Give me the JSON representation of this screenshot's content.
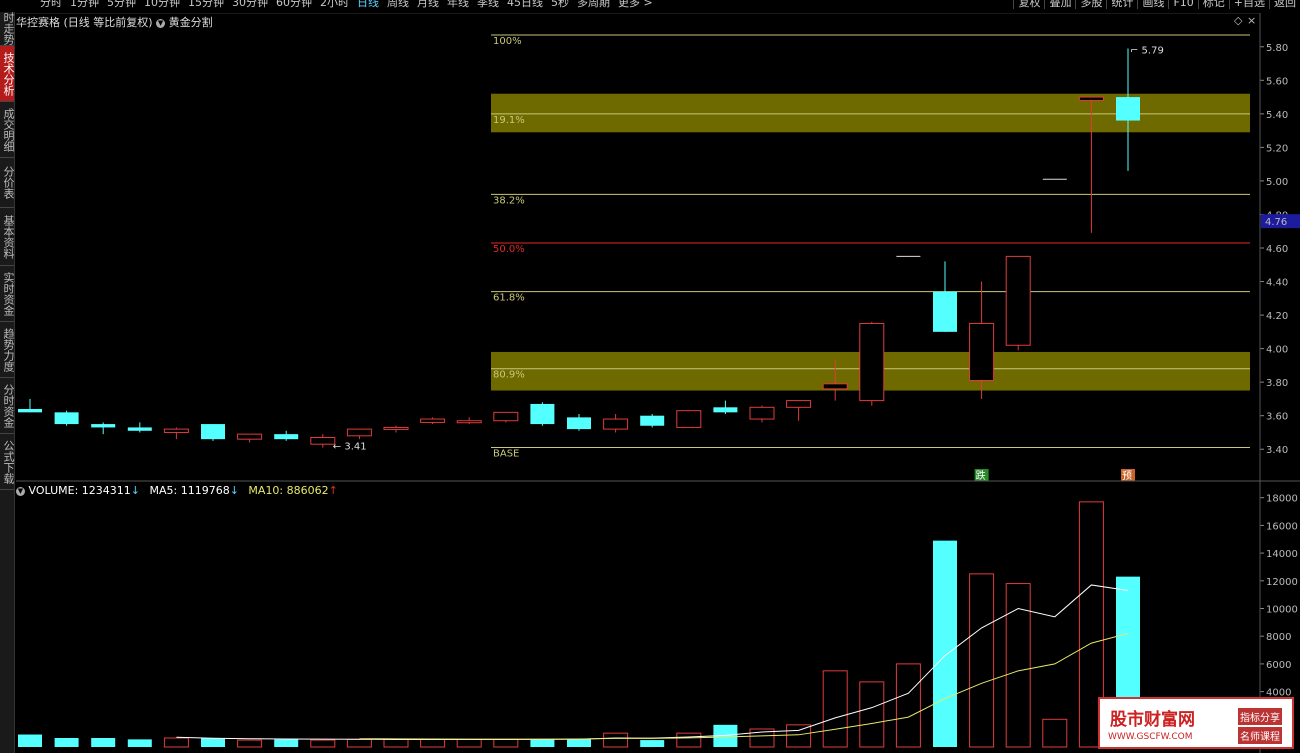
{
  "topbar": {
    "periods": [
      "分时",
      "1分钟",
      "5分钟",
      "10分钟",
      "15分钟",
      "30分钟",
      "60分钟",
      "2小时",
      "日线",
      "周线",
      "月线",
      "年线",
      "季线",
      "45日线",
      "5秒",
      "多周期",
      "更多"
    ],
    "active_period": "日线",
    "right_buttons": [
      "复权",
      "叠加",
      "多股",
      "统计",
      "画线",
      "F10",
      "标记",
      "+自选",
      "返回"
    ]
  },
  "sidetabs": [
    "分时走势",
    "技术分析",
    "成交明细",
    "分价表",
    "基本资料",
    "实时资金",
    "趋势力度",
    "分时资金",
    "公式下载"
  ],
  "active_sidetab": "技术分析",
  "info": {
    "stock_name": "华控赛格",
    "mode": "(日线 等比前复权)",
    "indicator": "黄金分割"
  },
  "price_axis": [
    "5.80",
    "5.60",
    "5.40",
    "5.20",
    "5.00",
    "4.80",
    "4.60",
    "4.40",
    "4.20",
    "4.00",
    "3.80",
    "3.60",
    "3.40"
  ],
  "current_price_tag": "4.76",
  "fib_levels": [
    {
      "label": "100%",
      "price": 5.87,
      "color": "#c8c878"
    },
    {
      "label": "19.1%",
      "price": 5.4,
      "color": "#c8c878"
    },
    {
      "label": "38.2%",
      "price": 4.92,
      "color": "#c8c878"
    },
    {
      "label": "50.0%",
      "price": 4.63,
      "color": "#e02828"
    },
    {
      "label": "61.8%",
      "price": 4.34,
      "color": "#c8c878"
    },
    {
      "label": "80.9%",
      "price": 3.88,
      "color": "#c8c878"
    },
    {
      "label": "BASE",
      "price": 3.41,
      "color": "#c8c878"
    }
  ],
  "fib_bands": [
    {
      "low": 5.29,
      "high": 5.52
    },
    {
      "low": 3.75,
      "high": 3.98
    }
  ],
  "high_label": "5.79",
  "low_label": "3.41",
  "markers": [
    {
      "text": "跌",
      "bar": 26,
      "color": "#2a8a2a"
    },
    {
      "text": "预",
      "bar": 30,
      "color": "#c8642a"
    }
  ],
  "volume_legend": {
    "volume": "VOLUME: 1234311",
    "ma5": "MA5: 1119768",
    "ma10": "MA10: 886062",
    "volume_color": "#ffffff",
    "ma5_color": "#ffffff",
    "ma10_color": "#e8e86a"
  },
  "volume_axis": [
    "18000",
    "16000",
    "14000",
    "12000",
    "10000",
    "8000",
    "6000",
    "4000"
  ],
  "chart_data": {
    "type": "candlestick",
    "title": "华控赛格 日线 等比前复权",
    "candles": [
      {
        "o": 3.64,
        "h": 3.7,
        "l": 3.62,
        "c": 3.62
      },
      {
        "o": 3.62,
        "h": 3.63,
        "l": 3.54,
        "c": 3.55
      },
      {
        "o": 3.55,
        "h": 3.56,
        "l": 3.49,
        "c": 3.53
      },
      {
        "o": 3.53,
        "h": 3.56,
        "l": 3.5,
        "c": 3.51
      },
      {
        "o": 3.5,
        "h": 3.53,
        "l": 3.46,
        "c": 3.52
      },
      {
        "o": 3.55,
        "h": 3.55,
        "l": 3.45,
        "c": 3.46
      },
      {
        "o": 3.46,
        "h": 3.49,
        "l": 3.44,
        "c": 3.49
      },
      {
        "o": 3.49,
        "h": 3.51,
        "l": 3.45,
        "c": 3.46
      },
      {
        "o": 3.43,
        "h": 3.49,
        "l": 3.41,
        "c": 3.47
      },
      {
        "o": 3.48,
        "h": 3.52,
        "l": 3.46,
        "c": 3.52
      },
      {
        "o": 3.52,
        "h": 3.54,
        "l": 3.5,
        "c": 3.53
      },
      {
        "o": 3.56,
        "h": 3.59,
        "l": 3.55,
        "c": 3.58
      },
      {
        "o": 3.56,
        "h": 3.59,
        "l": 3.55,
        "c": 3.57
      },
      {
        "o": 3.57,
        "h": 3.62,
        "l": 3.56,
        "c": 3.62
      },
      {
        "o": 3.67,
        "h": 3.68,
        "l": 3.54,
        "c": 3.55
      },
      {
        "o": 3.59,
        "h": 3.61,
        "l": 3.51,
        "c": 3.52
      },
      {
        "o": 3.52,
        "h": 3.61,
        "l": 3.5,
        "c": 3.58
      },
      {
        "o": 3.6,
        "h": 3.61,
        "l": 3.53,
        "c": 3.54
      },
      {
        "o": 3.53,
        "h": 3.63,
        "l": 3.53,
        "c": 3.63
      },
      {
        "o": 3.65,
        "h": 3.69,
        "l": 3.61,
        "c": 3.62
      },
      {
        "o": 3.58,
        "h": 3.66,
        "l": 3.56,
        "c": 3.65
      },
      {
        "o": 3.65,
        "h": 3.69,
        "l": 3.57,
        "c": 3.69
      },
      {
        "o": 3.76,
        "h": 3.93,
        "l": 3.69,
        "c": 3.79
      },
      {
        "o": 3.69,
        "h": 4.16,
        "l": 3.66,
        "c": 4.15
      },
      {
        "o": 4.55,
        "h": 4.55,
        "l": 4.55,
        "c": 4.55
      },
      {
        "o": 4.34,
        "h": 4.52,
        "l": 4.1,
        "c": 4.1
      },
      {
        "o": 3.81,
        "h": 4.4,
        "l": 3.7,
        "c": 4.15
      },
      {
        "o": 4.02,
        "h": 4.55,
        "l": 3.99,
        "c": 4.55
      },
      {
        "o": 5.01,
        "h": 5.01,
        "l": 5.01,
        "c": 5.01
      },
      {
        "o": 5.48,
        "h": 5.5,
        "l": 4.69,
        "c": 5.5
      },
      {
        "o": 5.5,
        "h": 5.79,
        "l": 5.06,
        "c": 5.36
      }
    ],
    "volume": [
      900,
      650,
      650,
      550,
      650,
      650,
      500,
      550,
      500,
      550,
      550,
      550,
      550,
      550,
      550,
      600,
      1000,
      500,
      1000,
      1600,
      1300,
      1600,
      5500,
      4700,
      6000,
      14900,
      12500,
      11800,
      2000,
      17700,
      12300
    ],
    "ma5": [
      null,
      null,
      null,
      null,
      700,
      630,
      600,
      580,
      570,
      560,
      540,
      540,
      540,
      540,
      550,
      560,
      650,
      640,
      720,
      840,
      1080,
      1200,
      2100,
      2840,
      3880,
      6600,
      8600,
      10000,
      9400,
      11700,
      11300
    ],
    "ma10": [
      null,
      null,
      null,
      null,
      null,
      null,
      null,
      null,
      null,
      600,
      590,
      580,
      570,
      570,
      570,
      580,
      620,
      620,
      660,
      720,
      800,
      880,
      1280,
      1700,
      2160,
      3500,
      4600,
      5500,
      6000,
      7500,
      8200
    ],
    "ylim": [
      3.3,
      5.9
    ],
    "vol_ylim": [
      0,
      18700
    ]
  }
}
